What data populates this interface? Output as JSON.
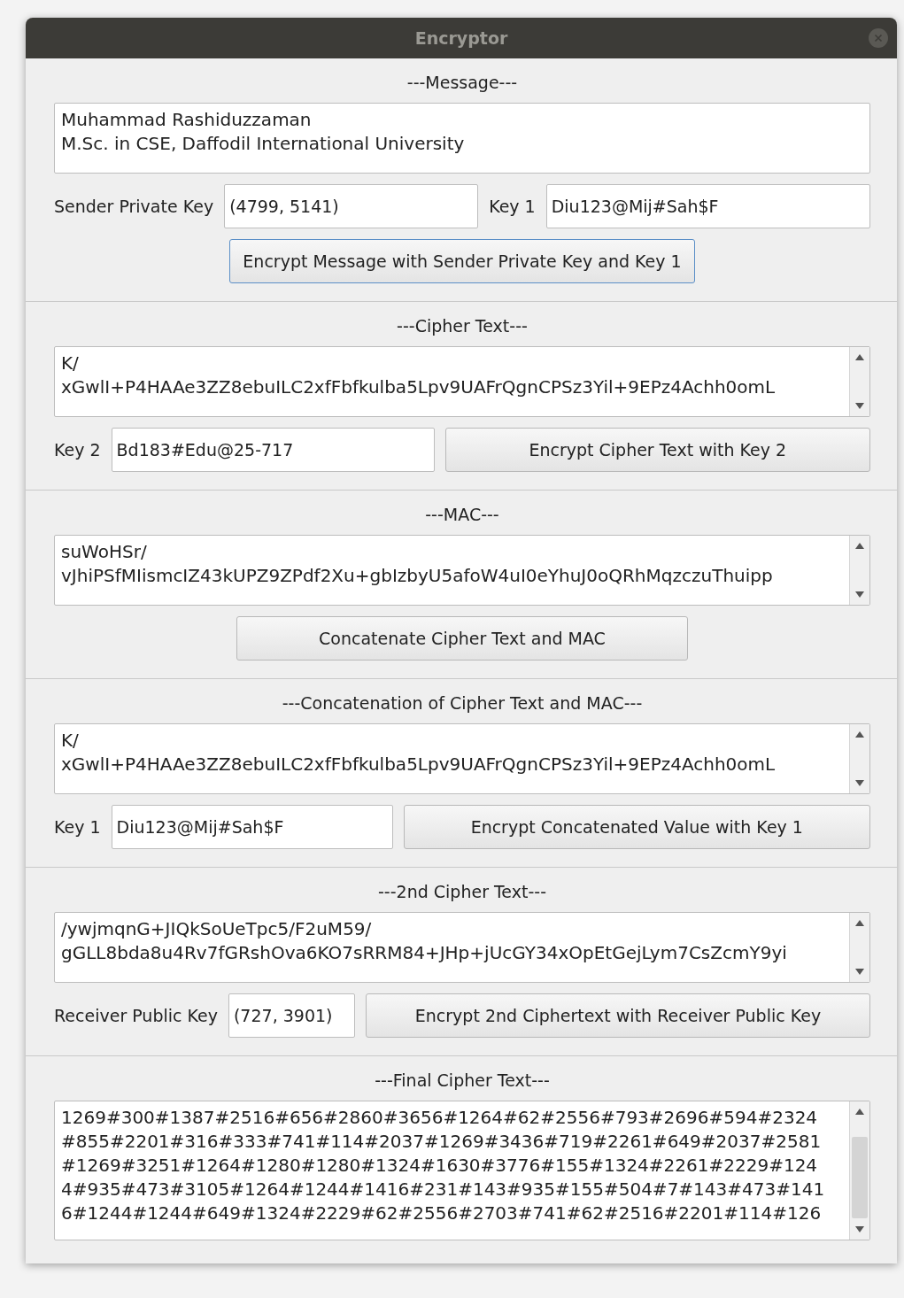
{
  "window": {
    "title": "Encryptor"
  },
  "sections": [
    {
      "heading": "---Message---",
      "text": {
        "lines": [
          "Muhammad Rashiduzzaman",
          "M.Sc. in CSE, Daffodil International University"
        ],
        "scrollable": false
      },
      "row": [
        {
          "kind": "label",
          "text": "Sender Private Key"
        },
        {
          "kind": "input",
          "value": "(4799, 5141)"
        },
        {
          "kind": "label",
          "text": "Key 1"
        },
        {
          "kind": "input",
          "value": "Diu123@Mij#Sah$F"
        }
      ],
      "button": "Encrypt Message with Sender Private Key and Key 1"
    },
    {
      "heading": "---Cipher Text---",
      "text": {
        "lines": [
          "K/",
          "xGwlI+P4HAAe3ZZ8ebuILC2xfFbfkulba5Lpv9UAFrQgnCPSz3Yil+9EPz4Achh0omL"
        ],
        "scrollable": true
      },
      "row": [
        {
          "kind": "label",
          "text": "Key 2"
        },
        {
          "kind": "input",
          "value": "Bd183#Edu@25-717"
        },
        {
          "kind": "button",
          "text": "Encrypt Cipher Text with Key 2"
        }
      ]
    },
    {
      "heading": "---MAC---",
      "text": {
        "lines": [
          "suWoHSr/",
          "vJhiPSfMIismcIZ43kUPZ9ZPdf2Xu+gbIzbyU5afoW4uI0eYhuJ0oQRhMqzczuThuipp"
        ],
        "scrollable": true
      },
      "button": "Concatenate Cipher Text and MAC"
    },
    {
      "heading": "---Concatenation of Cipher Text and MAC---",
      "text": {
        "lines": [
          "K/",
          "xGwlI+P4HAAe3ZZ8ebuILC2xfFbfkulba5Lpv9UAFrQgnCPSz3Yil+9EPz4Achh0omL"
        ],
        "scrollable": true
      },
      "row": [
        {
          "kind": "label",
          "text": "Key 1"
        },
        {
          "kind": "input",
          "value": "Diu123@Mij#Sah$F"
        },
        {
          "kind": "button",
          "text": "Encrypt Concatenated Value with Key 1"
        }
      ]
    },
    {
      "heading": "---2nd Cipher Text---",
      "text": {
        "lines": [
          "/ywjmqnG+JIQkSoUeTpc5/F2uM59/",
          "gGLL8bda8u4Rv7fGRshOva6KO7sRRM84+JHp+jUcGY34xOpEtGejLym7CsZcmY9yi"
        ],
        "scrollable": true
      },
      "row": [
        {
          "kind": "label",
          "text": "Receiver Public Key"
        },
        {
          "kind": "input",
          "value": "(727, 3901)"
        },
        {
          "kind": "button",
          "text": "Encrypt 2nd Ciphertext with Receiver Public Key"
        }
      ]
    },
    {
      "heading": "---Final Cipher Text---",
      "text": {
        "lines": [
          "1269#300#1387#2516#656#2860#3656#1264#62#2556#793#2696#594#2324",
          "#855#2201#316#333#741#114#2037#1269#3436#719#2261#649#2037#2581",
          "#1269#3251#1264#1280#1280#1324#1630#3776#155#1324#2261#2229#124",
          "4#935#473#3105#1264#1244#1416#231#143#935#155#504#7#143#473#141",
          "6#1244#1244#649#1324#2229#62#2556#2703#741#62#2516#2201#114#126"
        ],
        "scrollable": true
      }
    }
  ]
}
